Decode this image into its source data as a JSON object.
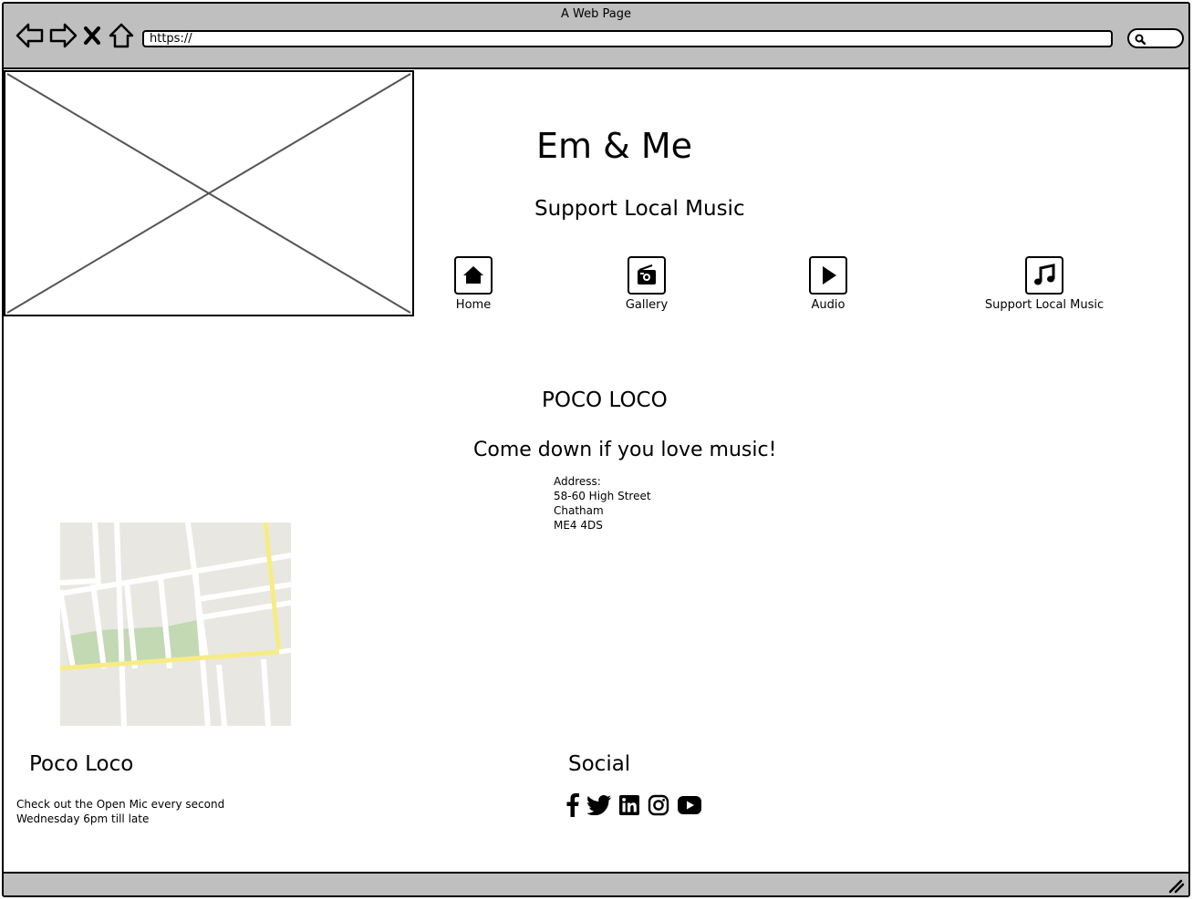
{
  "window": {
    "title": "A Web Page"
  },
  "browser": {
    "url": "https://"
  },
  "header": {
    "site_title": "Em & Me",
    "subtitle": "Support Local Music"
  },
  "nav": [
    {
      "label": "Home",
      "icon": "home-icon"
    },
    {
      "label": "Gallery",
      "icon": "radio-icon"
    },
    {
      "label": "Audio",
      "icon": "play-icon"
    },
    {
      "label": "Support Local Music",
      "icon": "music-note-icon"
    }
  ],
  "venue": {
    "name": "POCO LOCO",
    "tagline": "Come down if you love music!",
    "address_label": "Address:",
    "address_lines": [
      "58-60 High Street",
      "Chatham",
      "ME4 4DS"
    ]
  },
  "footer": {
    "left_heading": "Poco Loco",
    "left_text": "Check out the Open Mic every second Wednesday 6pm till late",
    "right_heading": "Social",
    "social_icons": [
      "facebook-icon",
      "twitter-icon",
      "linkedin-icon",
      "instagram-icon",
      "youtube-icon"
    ]
  },
  "colors": {
    "chrome": "#bfbfbf",
    "map_bg": "#e9e7e1",
    "map_road_major": "#f7ec84",
    "map_park": "#c2d9b3"
  }
}
